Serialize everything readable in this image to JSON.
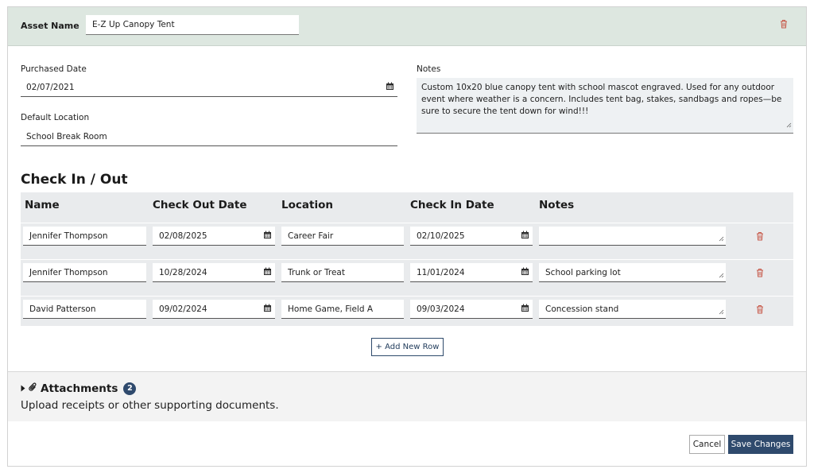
{
  "header": {
    "asset_name_label": "Asset Name",
    "asset_name_value": "E-Z Up Canopy Tent"
  },
  "details": {
    "purchased_date_label": "Purchased Date",
    "purchased_date_value": "02/07/2021",
    "default_location_label": "Default Location",
    "default_location_value": "School Break Room",
    "notes_label": "Notes",
    "notes_value": "Custom 10x20 blue canopy tent with school mascot engraved. Used for any outdoor event where weather is a concern. Includes tent bag, stakes, sandbags and ropes—be sure to secure the tent down for wind!!!"
  },
  "checkinout": {
    "title": "Check In / Out",
    "columns": [
      "Name",
      "Check Out Date",
      "Location",
      "Check In Date",
      "Notes"
    ],
    "rows": [
      {
        "name": "Jennifer Thompson",
        "check_out": "02/08/2025",
        "location": "Career Fair",
        "check_in": "02/10/2025",
        "notes": ""
      },
      {
        "name": "Jennifer Thompson",
        "check_out": "10/28/2024",
        "location": "Trunk or Treat",
        "check_in": "11/01/2024",
        "notes": "School parking lot"
      },
      {
        "name": "David Patterson",
        "check_out": "09/02/2024",
        "location": "Home Game, Field A",
        "check_in": "09/03/2024",
        "notes": "Concession stand"
      }
    ],
    "add_row_label": "+ Add New Row"
  },
  "attachments": {
    "title": "Attachments",
    "count": "2",
    "description": "Upload receipts or other supporting documents."
  },
  "footer": {
    "cancel_label": "Cancel",
    "save_label": "Save Changes"
  },
  "colors": {
    "header_bg": "#dde7e0",
    "primary": "#2f4a6d",
    "delete": "#c75a4a"
  },
  "icons": [
    "trash-icon",
    "calendar-icon",
    "resize-handle-icon",
    "caret-right-icon",
    "paperclip-icon"
  ]
}
